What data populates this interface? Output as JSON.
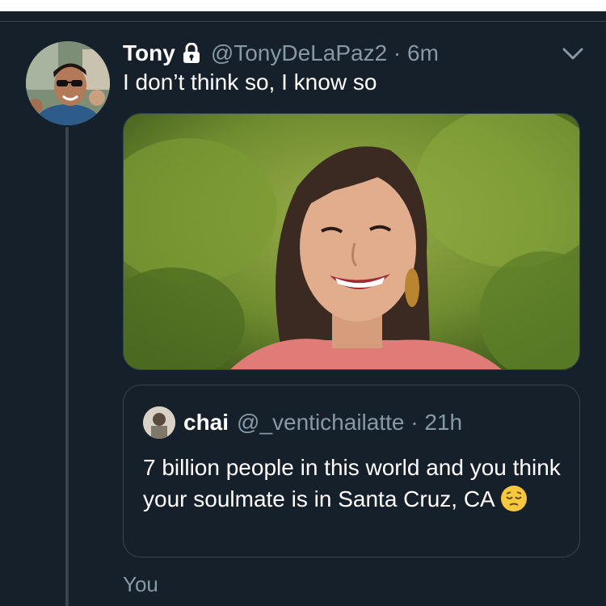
{
  "tweet": {
    "name": "Tony",
    "handle_time": "@TonyDeLaPaz2 · 6m",
    "text": "I don’t think so, I know so",
    "icons": {
      "lock": "lock-icon",
      "menu": "chevron-down-icon"
    }
  },
  "quoted": {
    "name": "chai",
    "handle_time": "@_ventichailatte · 21h",
    "text": "7 billion people in this world and you think your soulmate is in Santa Cruz, CA",
    "emoji": "pensive-face-emoji"
  },
  "reply_context": {
    "label": "You"
  },
  "colors": {
    "background": "#15202b",
    "border": "#38444d",
    "secondary_text": "#8899a6"
  }
}
